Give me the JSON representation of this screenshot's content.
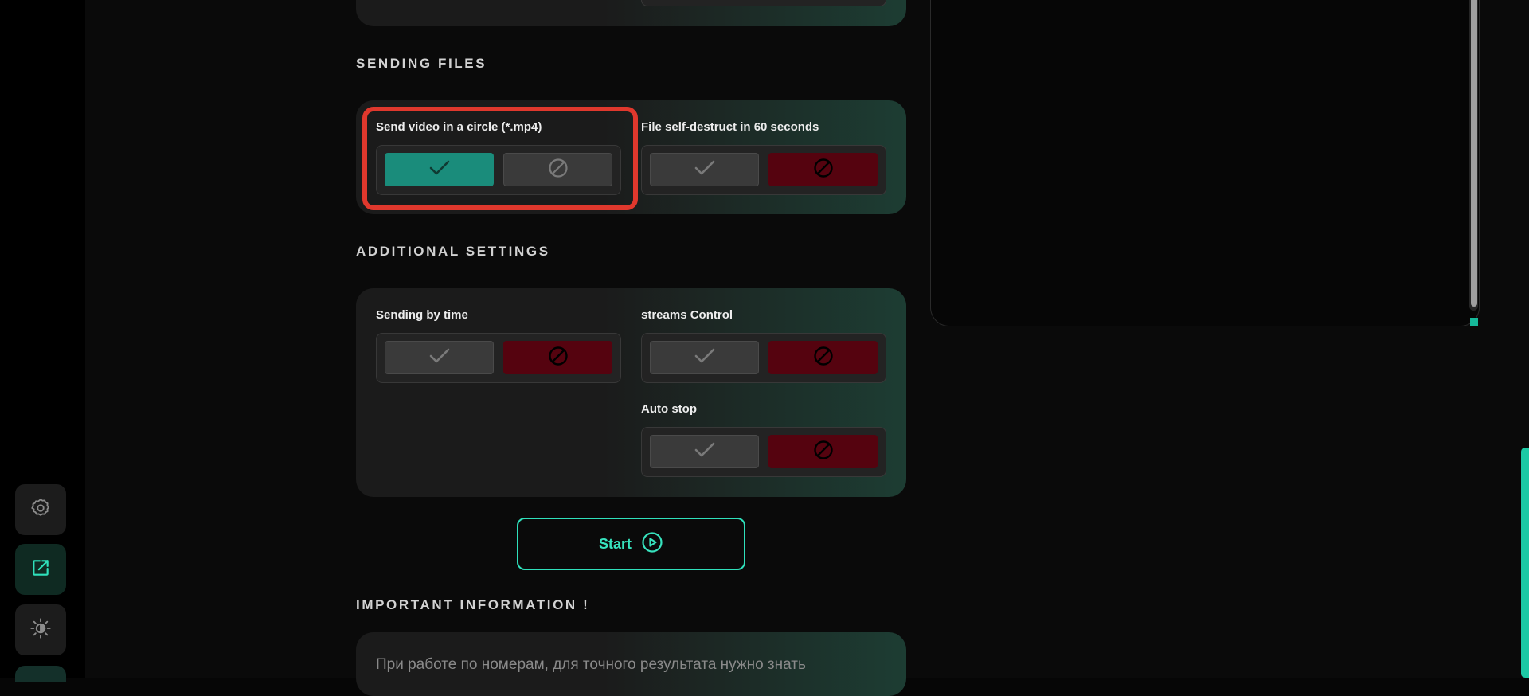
{
  "sections": {
    "sending_files": "SENDING FILES",
    "additional_settings": "ADDITIONAL SETTINGS",
    "important_information": "IMPORTANT INFORMATION !"
  },
  "options": {
    "send_video_circle": {
      "label": "Send video in a circle (*.mp4)",
      "enabled": true
    },
    "file_self_destruct": {
      "label": "File self-destruct in 60 seconds",
      "enabled": false
    },
    "sending_by_time": {
      "label": "Sending by time",
      "enabled": false
    },
    "streams_control": {
      "label": "streams Control",
      "enabled": false
    },
    "auto_stop": {
      "label": "Auto stop",
      "enabled": false
    }
  },
  "start_button": {
    "label": "Start"
  },
  "info": {
    "text": "При работе по номерам, для точного результата нужно знать"
  },
  "sidebar": {
    "items": [
      {
        "icon": "gear-icon"
      },
      {
        "icon": "external-link-icon"
      },
      {
        "icon": "theme-toggle-icon"
      }
    ]
  },
  "colors": {
    "accent": "#37e3be",
    "enabled_check": "#1a8c7b",
    "disabled_ban": "#55030f",
    "highlight": "#e0382d"
  }
}
